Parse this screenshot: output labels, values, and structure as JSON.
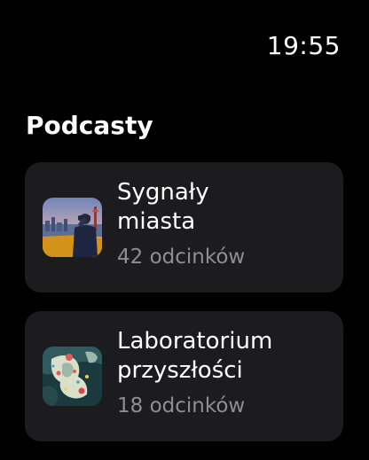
{
  "status_bar": {
    "time": "19:55"
  },
  "page": {
    "title": "Podcasty"
  },
  "podcasts": [
    {
      "title": "Sygnały\nmiasta",
      "episodes": "42 odcinków",
      "artwork_icon": "city-skyline-artwork"
    },
    {
      "title": "Laboratorium\nprzyszłości",
      "episodes": "18 odcinków",
      "artwork_icon": "abstract-map-artwork"
    }
  ],
  "colors": {
    "background": "#000000",
    "card": "#1c1c1e",
    "secondary_text": "#8e8e93"
  }
}
